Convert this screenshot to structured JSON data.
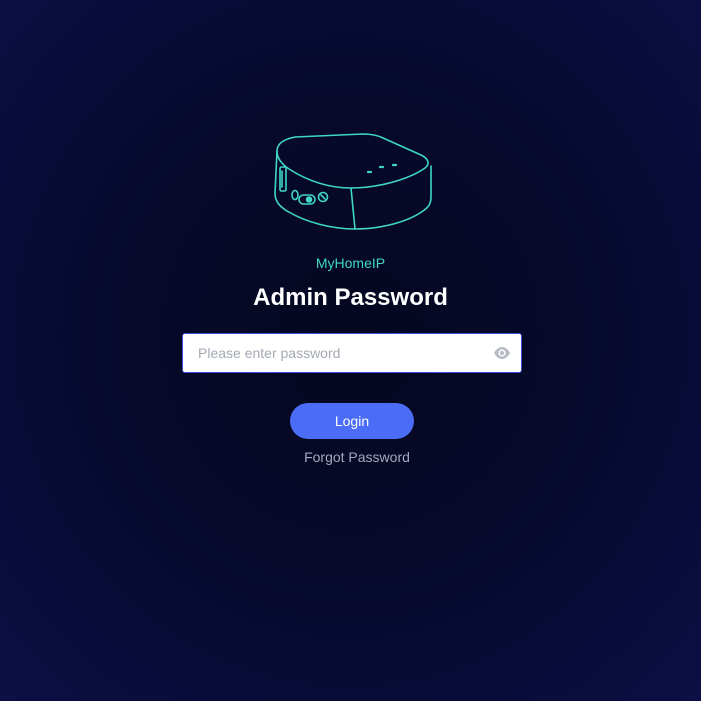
{
  "brand": {
    "name": "MyHomeIP",
    "accent_color": "#3fd6c8",
    "device_icon": "travel-router-icon"
  },
  "login": {
    "title": "Admin Password",
    "password_placeholder": "Please enter password",
    "password_value": "",
    "toggle_icon": "eye-icon",
    "submit_label": "Login",
    "submit_color": "#4a6cf7",
    "forgot_label": "Forgot Password"
  }
}
